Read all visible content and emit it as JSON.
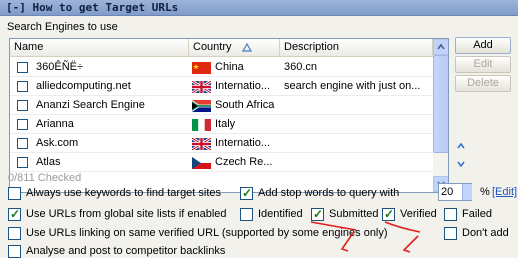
{
  "titlebar": {
    "text": "[-] How to get Target URLs"
  },
  "section": {
    "label": "Search Engines to use"
  },
  "table": {
    "columns": {
      "name": "Name",
      "country": "Country",
      "description": "Description"
    },
    "rows": [
      {
        "name": "360ÊÑË÷",
        "country": "China",
        "description": "360.cn",
        "flag": "china"
      },
      {
        "name": "alliedcomputing.net",
        "country": "Internatio...",
        "description": "search engine with just on...",
        "flag": "uk"
      },
      {
        "name": "Ananzi Search Engine",
        "country": "South Africa",
        "description": "",
        "flag": "south-africa"
      },
      {
        "name": "Arianna",
        "country": "Italy",
        "description": "",
        "flag": "italy"
      },
      {
        "name": "Ask.com",
        "country": "Internatio...",
        "description": "",
        "flag": "uk"
      },
      {
        "name": "Atlas",
        "country": "Czech Re...",
        "description": "",
        "flag": "czech"
      }
    ]
  },
  "buttons": {
    "add": "Add",
    "edit": "Edit",
    "delete": "Delete"
  },
  "checked_count": "0/811 Checked",
  "options": {
    "always_keywords": "Always use keywords to find target sites",
    "add_stop_words": "Add stop words to query with",
    "stop_words_value": "20",
    "percent": "%",
    "edit_link": "[Edit]",
    "use_global_lists": "Use URLs from global site lists if enabled",
    "identified": "Identified",
    "submitted": "Submitted",
    "verified": "Verified",
    "failed": "Failed",
    "use_linking": "Use URLs linking on same verified URL (supported by some engines only)",
    "dont_add": "Don't add",
    "analyse": "Analyse and post to competitor backlinks"
  },
  "checked": {
    "always_keywords": false,
    "add_stop_words": true,
    "use_global_lists": true,
    "identified": false,
    "submitted": true,
    "verified": true,
    "failed": false,
    "use_linking": false,
    "dont_add": false,
    "analyse": false
  },
  "icons": {
    "sort": "sort-ascending-icon",
    "scroll_up": "chevron-up-icon",
    "scroll_down": "chevron-down-icon"
  },
  "colors": {
    "annotation": "#e0201a",
    "link": "#1f52ba"
  }
}
